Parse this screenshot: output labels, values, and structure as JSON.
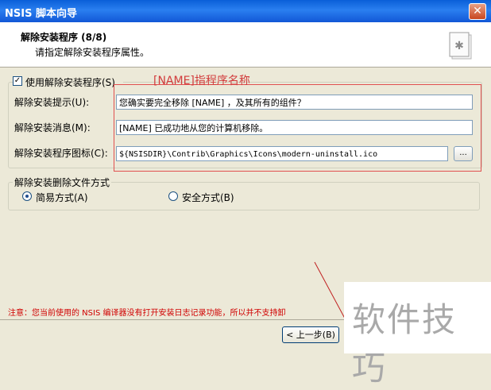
{
  "window": {
    "title": "NSIS 脚本向导",
    "close_glyph": "✕"
  },
  "header": {
    "title": "解除安装程序 (8/8)",
    "subtitle": "请指定解除安装程序属性。",
    "icon": "installer-page-icon"
  },
  "uninstall_group": {
    "checkbox_label": "使用解除安装程序(S)",
    "checked": true,
    "prompt_label": "解除安装提示(U):",
    "prompt_value": "您确实要完全移除 [NAME] ，及其所有的组件？",
    "message_label": "解除安装消息(M):",
    "message_value": "[NAME] 已成功地从您的计算机移除。",
    "icon_label": "解除安装程序图标(C):",
    "icon_value": "${NSISDIR}\\Contrib\\Graphics\\Icons\\modern-uninstall.ico",
    "browse_label": "..."
  },
  "annotation": {
    "text": "[NAME]指程序名称",
    "color": "#d23c3c"
  },
  "delete_mode": {
    "legend": "解除安装删除文件方式",
    "options": [
      "简易方式(A)",
      "安全方式(B)"
    ],
    "selected": "简易方式(A)"
  },
  "notice": "注意：您当前使用的 NSIS 编译器没有打开安装日志记录功能，所以并不支持卸",
  "footer": {
    "back_label": "< 上一步(B)"
  },
  "watermark": "软件技巧",
  "colors": {
    "titlebar": "#0a5fd8",
    "dialog": "#ece9d8",
    "notice": "#d00000"
  }
}
